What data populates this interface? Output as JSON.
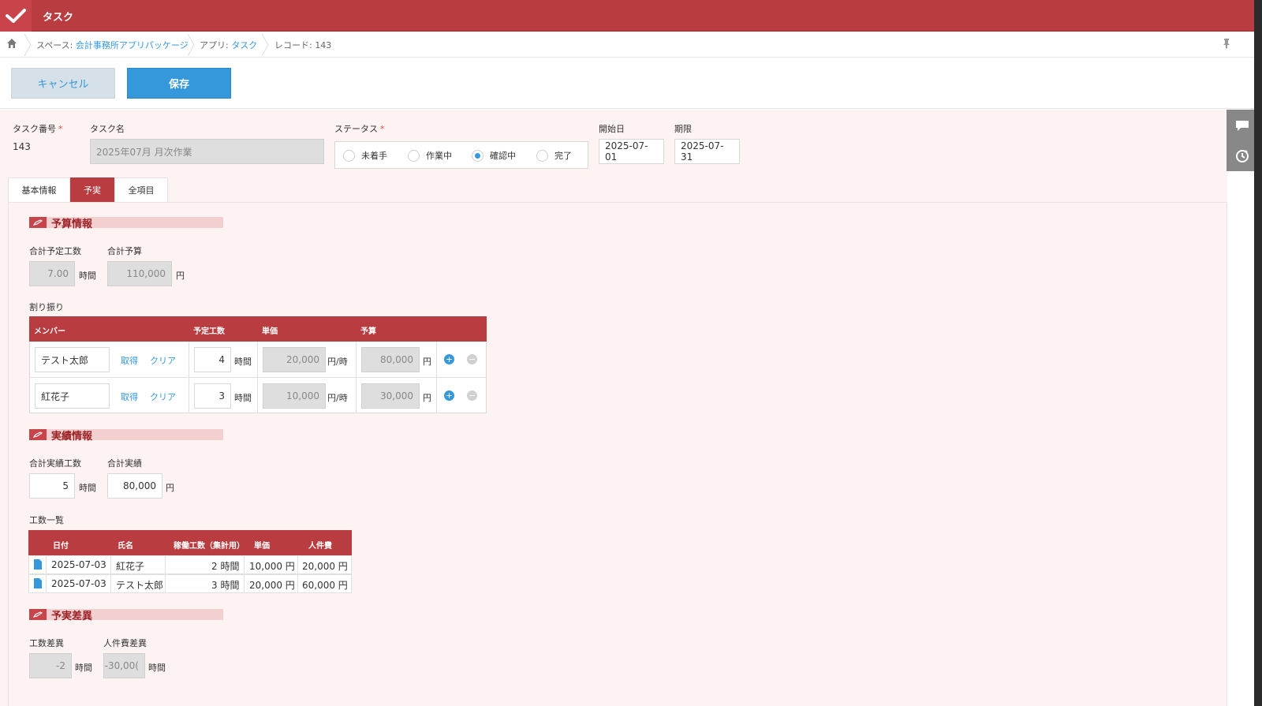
{
  "app": {
    "title": "タスク"
  },
  "breadcrumb": {
    "space_prefix": "スペース: ",
    "space_name": "会計事務所アプリパッケージ",
    "app_prefix": "アプリ: ",
    "app_name": "タスク",
    "record": "レコード: 143"
  },
  "actions": {
    "cancel": "キャンセル",
    "save": "保存"
  },
  "header_fields": {
    "task_number_label": "タスク番号",
    "task_number_value": "143",
    "task_name_label": "タスク名",
    "task_name_value": "2025年07月 月次作業",
    "status_label": "ステータス",
    "status_options": [
      "未着手",
      "作業中",
      "確認中",
      "完了"
    ],
    "status_selected": "確認中",
    "start_label": "開始日",
    "start_value": "2025-07-01",
    "due_label": "期限",
    "due_value": "2025-07-31",
    "required_mark": "*"
  },
  "tabs": [
    "基本情報",
    "予実",
    "全項目"
  ],
  "active_tab": "予実",
  "budget": {
    "section_title": "予算情報",
    "total_hours_label": "合計予定工数",
    "total_hours_value": "7.00",
    "total_hours_unit": "時間",
    "total_budget_label": "合計予算",
    "total_budget_value": "110,000",
    "total_budget_unit": "円",
    "allocation_label": "割り振り",
    "columns": [
      "メンバー",
      "予定工数",
      "単価",
      "予算"
    ],
    "link_get": "取得",
    "link_clear": "クリア",
    "hours_unit": "時間",
    "rate_unit": "円/時",
    "yen_unit": "円",
    "rows": [
      {
        "member": "テスト太郎",
        "hours": "4",
        "rate": "20,000",
        "budget": "80,000"
      },
      {
        "member": "紅花子",
        "hours": "3",
        "rate": "10,000",
        "budget": "30,000"
      }
    ]
  },
  "actual": {
    "section_title": "実績情報",
    "total_hours_label": "合計実績工数",
    "total_hours_value": "5",
    "total_hours_unit": "時間",
    "total_cost_label": "合計実績",
    "total_cost_value": "80,000",
    "total_cost_unit": "円",
    "list_label": "工数一覧",
    "columns": [
      "日付",
      "氏名",
      "稼働工数（集計用）",
      "単価",
      "人件費"
    ],
    "rows": [
      {
        "date": "2025-07-03",
        "name": "紅花子",
        "hours": "2 時間",
        "rate": "10,000 円",
        "cost": "20,000 円"
      },
      {
        "date": "2025-07-03",
        "name": "テスト太郎",
        "hours": "3 時間",
        "rate": "20,000 円",
        "cost": "60,000 円"
      }
    ]
  },
  "variance": {
    "section_title": "予実差異",
    "hours_diff_label": "工数差異",
    "hours_diff_value": "-2",
    "hours_diff_unit": "時間",
    "cost_diff_label": "人件費差異",
    "cost_diff_value": "-30,00(",
    "cost_diff_unit": "時間"
  },
  "colors": {
    "brand": "#b83c40",
    "accent": "#3498db",
    "section_bg": "#f3cfd0"
  },
  "icons": [
    "check-icon",
    "home-icon",
    "pin-icon",
    "comment-icon",
    "history-icon",
    "pencil-icon",
    "document-icon",
    "plus-icon",
    "minus-icon"
  ]
}
